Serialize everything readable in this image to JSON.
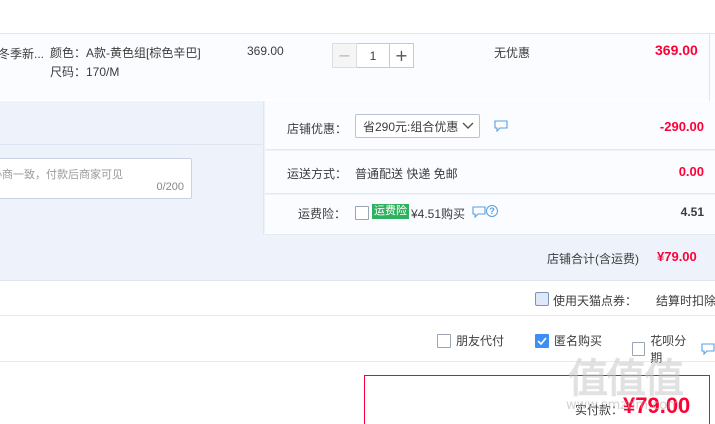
{
  "item": {
    "title": "冬季新...",
    "sku_color": "颜色：A款-黄色组[棕色辛巴]",
    "sku_size": "尺码：170/M",
    "unit_price": "369.00",
    "quantity": "1",
    "minus_label": "−",
    "plus_label": "+",
    "promo": "无优惠",
    "total": "369.00"
  },
  "message": {
    "placeholder": "协商一致，付款后商家可见",
    "count": "0/200"
  },
  "shop_discount": {
    "label": "店铺优惠：",
    "selected": "省290元:组合优惠",
    "amount": "-290.00"
  },
  "shipping": {
    "label": "运送方式：",
    "value": "普通配送 快递 免邮",
    "amount": "0.00"
  },
  "insurance": {
    "label": "运费险：",
    "badge": "运费险",
    "text": "¥4.51购买",
    "help": "?",
    "amount": "4.51"
  },
  "subtotal": {
    "label": "店铺合计(含运费)",
    "amount": "¥79.00"
  },
  "points": {
    "label": "使用天猫点券：",
    "note": "结算时扣除"
  },
  "options": {
    "friend_pay": "朋友代付",
    "anonymous": "匿名购买",
    "huabei": "花呗分期"
  },
  "payment": {
    "label": "实付款：",
    "amount": "¥79.00"
  },
  "watermark": {
    "logo": "值值值",
    "site": "www.smzdm.com"
  },
  "colors": {
    "price_red": "#ff0036",
    "panel_blue": "#eef3fb",
    "checkbox_blue": "#3e8ef7",
    "badge_green": "#2fb25e",
    "link_blue": "#55a0e6"
  }
}
